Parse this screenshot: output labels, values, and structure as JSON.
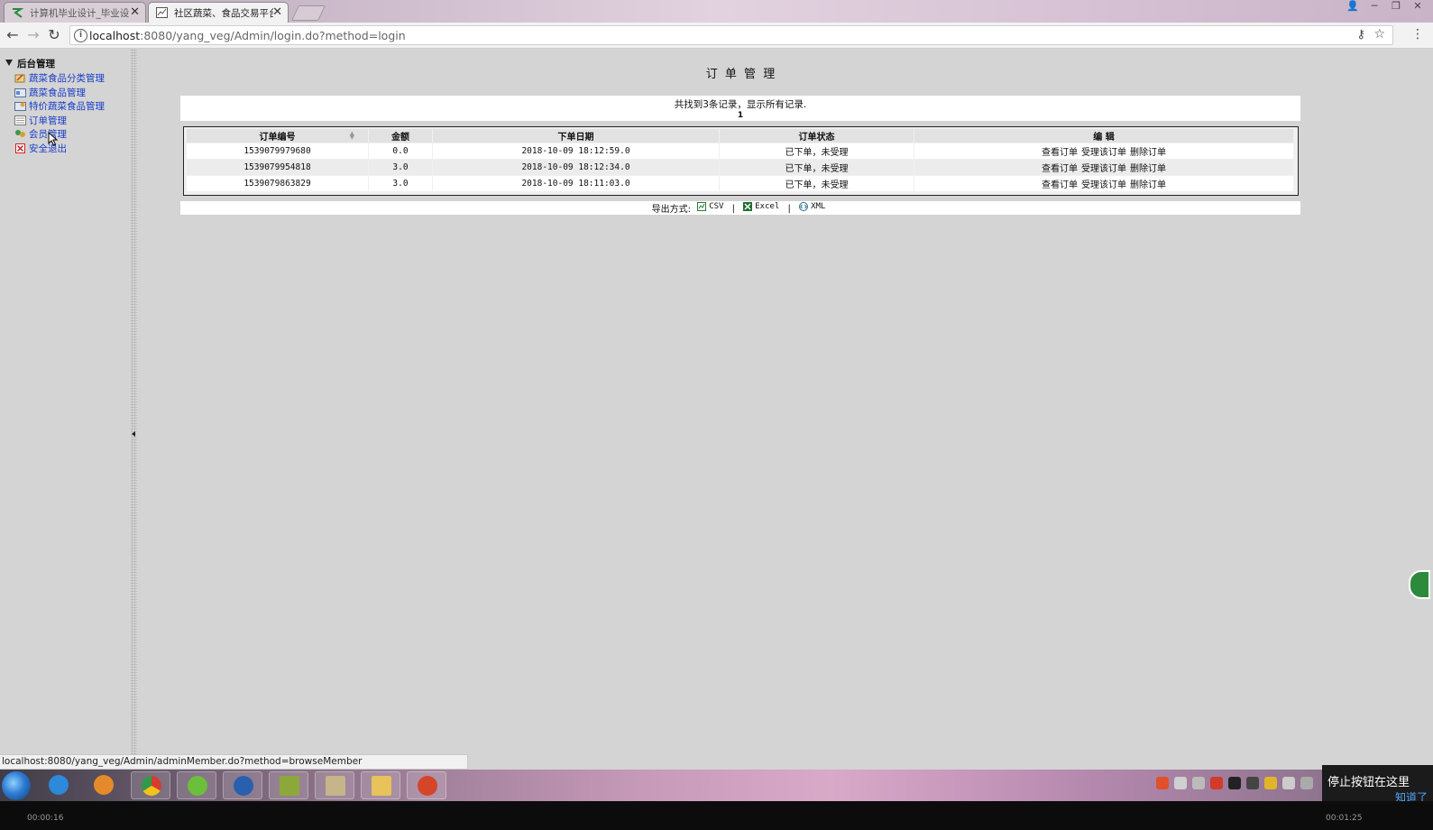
{
  "browser": {
    "tabs": [
      {
        "title": "计算机毕业设计_毕业设计",
        "active": false
      },
      {
        "title": "社区蔬菜、食品交易平台",
        "active": true
      }
    ],
    "url_host": "localhost",
    "url_path": ":8080/yang_veg/Admin/login.do?method=login",
    "status_url": "localhost:8080/yang_veg/Admin/adminMember.do?method=browseMember"
  },
  "sidebar": {
    "root": "后台管理",
    "items": [
      {
        "label": "蔬菜食品分类管理",
        "icon": "category-icon"
      },
      {
        "label": "蔬菜食品管理",
        "icon": "product-icon"
      },
      {
        "label": "特价蔬菜食品管理",
        "icon": "special-price-icon"
      },
      {
        "label": "订单管理",
        "icon": "order-icon"
      },
      {
        "label": "会员管理",
        "icon": "member-icon"
      },
      {
        "label": "安全退出",
        "icon": "logout-icon"
      }
    ]
  },
  "main": {
    "title": "订 单 管 理",
    "summary": "共找到3条记录，显示所有记录.",
    "page_number": "1",
    "columns": [
      "订单编号",
      "金额",
      "下单日期",
      "订单状态",
      "编 辑"
    ],
    "rows": [
      {
        "id": "1539079979680",
        "amount": "0.0",
        "date": "2018-10-09 18:12:59.0",
        "status": "已下单，未受理"
      },
      {
        "id": "1539079954818",
        "amount": "3.0",
        "date": "2018-10-09 18:12:34.0",
        "status": "已下单，未受理"
      },
      {
        "id": "1539079863829",
        "amount": "3.0",
        "date": "2018-10-09 18:11:03.0",
        "status": "已下单，未受理"
      }
    ],
    "actions": {
      "view": "查看订单",
      "accept": "受理该订单",
      "delete": "删除订单"
    },
    "export": {
      "label": "导出方式:",
      "csv": "CSV",
      "excel": "Excel",
      "xml": "XML",
      "separator": "|"
    }
  },
  "overlay": {
    "tooltip_text": "停止按钮在这里",
    "tooltip_link": "知道了",
    "time_left": "00:00:16",
    "time_right": "00:01:25"
  },
  "colors": {
    "link": "#1a3ec8",
    "header_bg": "#e2e2e2",
    "page_bg": "#d4d4d4"
  }
}
